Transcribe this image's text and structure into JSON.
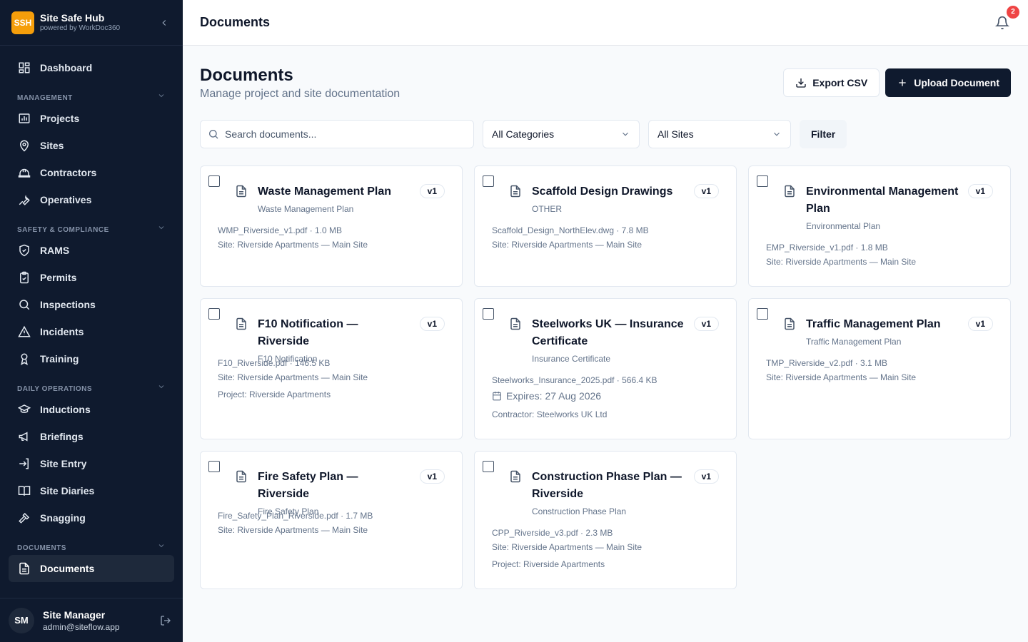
{
  "brand": {
    "logo": "SSH",
    "name": "Site Safe Hub",
    "sub": "powered by WorkDoc360"
  },
  "nav": {
    "dashboard": "Dashboard",
    "section_management": "MANAGEMENT",
    "projects": "Projects",
    "sites": "Sites",
    "contractors": "Contractors",
    "operatives": "Operatives",
    "section_safety": "SAFETY & COMPLIANCE",
    "rams": "RAMS",
    "permits": "Permits",
    "inspections": "Inspections",
    "incidents": "Incidents",
    "training": "Training",
    "section_daily": "DAILY OPERATIONS",
    "inductions": "Inductions",
    "briefings": "Briefings",
    "site_entry": "Site Entry",
    "site_diaries": "Site Diaries",
    "snagging": "Snagging",
    "section_documents": "DOCUMENTS",
    "documents": "Documents"
  },
  "user": {
    "initials": "SM",
    "name": "Site Manager",
    "email": "admin@siteflow.app"
  },
  "topbar": {
    "title": "Documents",
    "notifications": "2"
  },
  "page": {
    "title": "Documents",
    "subtitle": "Manage project and site documentation",
    "export_label": "Export CSV",
    "upload_label": "Upload Document"
  },
  "filters": {
    "search_placeholder": "Search documents...",
    "category": "All Categories",
    "site": "All Sites",
    "filter_label": "Filter"
  },
  "cards": [
    {
      "title": "Waste Management Plan",
      "category": "Waste Management Plan",
      "version": "v1",
      "file": "WMP_Riverside_v1.pdf · 1.0 MB",
      "site": "Site: Riverside Apartments — Main Site"
    },
    {
      "title": "Scaffold Design Drawings",
      "category": "OTHER",
      "version": "v1",
      "file": "Scaffold_Design_NorthElev.dwg · 7.8 MB",
      "site": "Site: Riverside Apartments — Main Site"
    },
    {
      "title": "Environmental Management Plan",
      "category": "Environmental Plan",
      "version": "v1",
      "file": "EMP_Riverside_v1.pdf · 1.8 MB",
      "site": "Site: Riverside Apartments — Main Site"
    },
    {
      "title": "F10 Notification — Riverside",
      "category": "F10 Notification",
      "version": "v1",
      "file": "F10_Riverside.pdf · 146.5 KB",
      "site": "Site: Riverside Apartments — Main Site",
      "project": "Project: Riverside Apartments"
    },
    {
      "title": "Steelworks UK — Insurance Certificate",
      "category": "Insurance Certificate",
      "version": "v1",
      "file": "Steelworks_Insurance_2025.pdf · 566.4 KB",
      "expires": "Expires: 27 Aug 2026",
      "contractor": "Contractor: Steelworks UK Ltd"
    },
    {
      "title": "Traffic Management Plan",
      "category": "Traffic Management Plan",
      "version": "v1",
      "file": "TMP_Riverside_v2.pdf · 3.1 MB",
      "site": "Site: Riverside Apartments — Main Site"
    },
    {
      "title": "Fire Safety Plan — Riverside",
      "category": "Fire Safety Plan",
      "version": "v1",
      "file": "Fire_Safety_Plan_Riverside.pdf · 1.7 MB",
      "site": "Site: Riverside Apartments — Main Site"
    },
    {
      "title": "Construction Phase Plan — Riverside",
      "category": "Construction Phase Plan",
      "version": "v1",
      "file": "CPP_Riverside_v3.pdf · 2.3 MB",
      "site": "Site: Riverside Apartments — Main Site",
      "project": "Project: Riverside Apartments"
    }
  ]
}
